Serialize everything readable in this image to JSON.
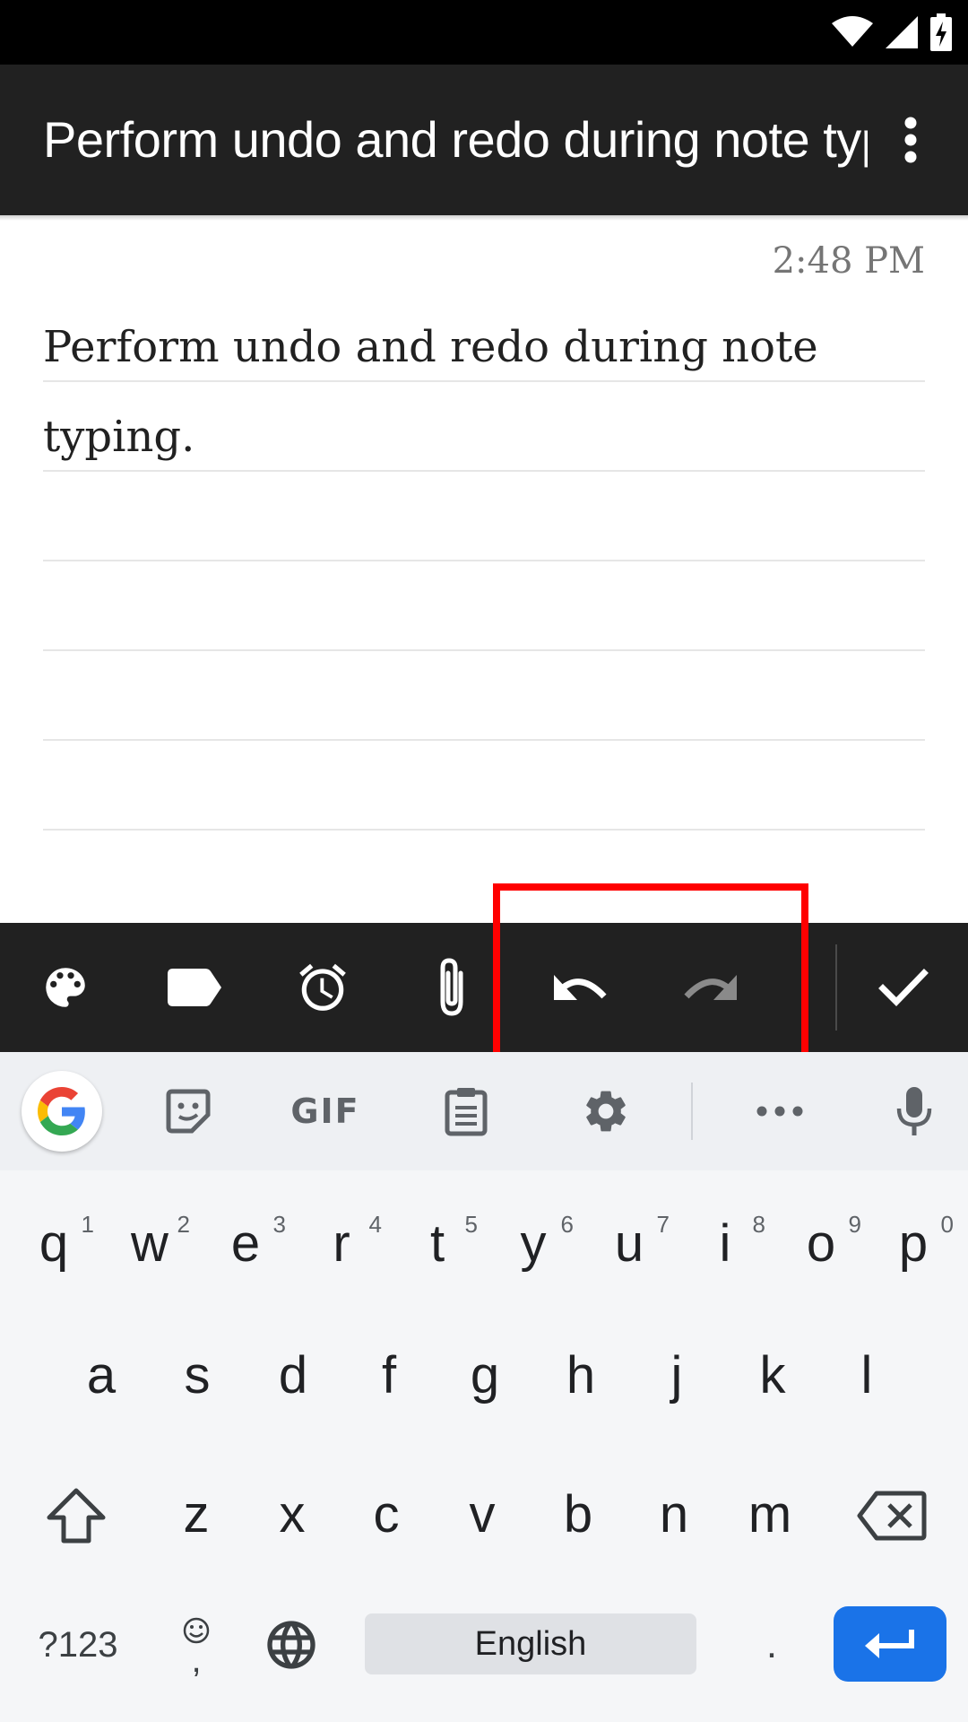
{
  "status_bar": {
    "icons": [
      "wifi-icon",
      "signal-icon",
      "battery-charging-icon"
    ]
  },
  "app_bar": {
    "title": "Perform undo and redo during note typ",
    "overflow_icon": "more-vert-icon"
  },
  "note": {
    "timestamp": "2:48 PM",
    "lines": [
      "Perform undo and redo during note",
      "typing.",
      "",
      "",
      "",
      ""
    ]
  },
  "toolbar": {
    "items": [
      "palette-icon",
      "label-icon",
      "alarm-icon",
      "attach-icon",
      "undo-icon",
      "redo-icon",
      "check-icon"
    ]
  },
  "keyboard": {
    "suggestion_bar": {
      "items": [
        "google-icon",
        "sticker-icon",
        "gif",
        "clipboard-icon",
        "settings-icon",
        "more-icon",
        "mic-icon"
      ],
      "gif_label": "GIF"
    },
    "row1": [
      {
        "key": "q",
        "hint": "1"
      },
      {
        "key": "w",
        "hint": "2"
      },
      {
        "key": "e",
        "hint": "3"
      },
      {
        "key": "r",
        "hint": "4"
      },
      {
        "key": "t",
        "hint": "5"
      },
      {
        "key": "y",
        "hint": "6"
      },
      {
        "key": "u",
        "hint": "7"
      },
      {
        "key": "i",
        "hint": "8"
      },
      {
        "key": "o",
        "hint": "9"
      },
      {
        "key": "p",
        "hint": "0"
      }
    ],
    "row2": [
      "a",
      "s",
      "d",
      "f",
      "g",
      "h",
      "j",
      "k",
      "l"
    ],
    "row3": [
      "z",
      "x",
      "c",
      "v",
      "b",
      "n",
      "m"
    ],
    "row4": {
      "symbols": "?123",
      "comma": ",",
      "space": "English",
      "period": "."
    }
  },
  "colors": {
    "app_bar": "#212121",
    "highlight": "#ff0000",
    "enter_key": "#1a73e8"
  }
}
